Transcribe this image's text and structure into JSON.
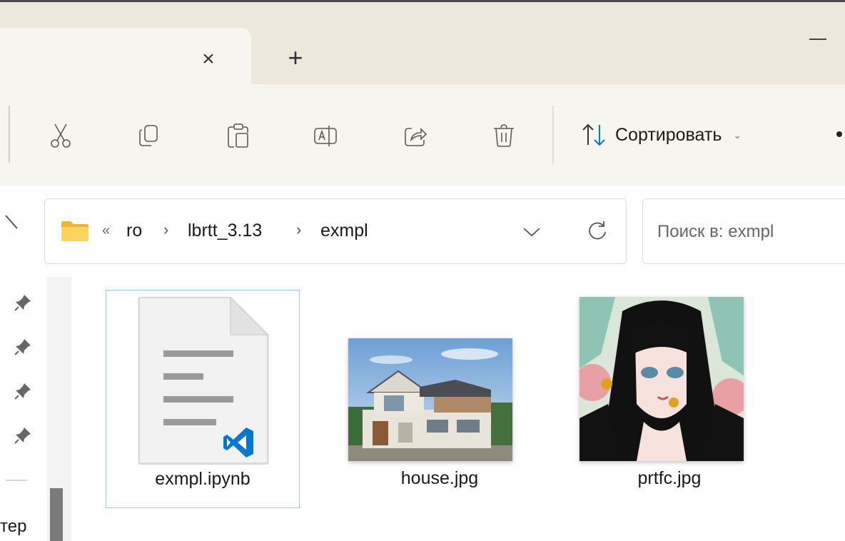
{
  "titlebar": {
    "tab_close_glyph": "×",
    "new_tab_glyph": "+"
  },
  "commandbar": {
    "buttons": [
      {
        "name": "cut-icon"
      },
      {
        "name": "copy-icon"
      },
      {
        "name": "paste-icon"
      },
      {
        "name": "rename-icon"
      },
      {
        "name": "share-icon"
      },
      {
        "name": "delete-icon"
      }
    ],
    "sort_label": "Сортировать",
    "sort_chevron": "⌄"
  },
  "address": {
    "overflow": "«",
    "crumbs": [
      "ro",
      "lbrtt_3.13",
      "exmpl"
    ],
    "separator": "›"
  },
  "search": {
    "placeholder": "Поиск в: exmpl"
  },
  "leftpane": {
    "partial_label": "тер"
  },
  "files": [
    {
      "name": "exmpl.ipynb",
      "selected": true,
      "icon": "vscode-notebook-icon"
    },
    {
      "name": "house.jpg",
      "selected": false,
      "icon": "house-thumbnail"
    },
    {
      "name": "prtfc.jpg",
      "selected": false,
      "icon": "portrait-thumbnail"
    }
  ],
  "colors": {
    "tabstrip": "#ece8dc",
    "toolbar": "#f7f5ef",
    "accent_blue": "#0078d4",
    "selection_border": "#99c9ef",
    "folder_yellow": "#f4c430"
  }
}
